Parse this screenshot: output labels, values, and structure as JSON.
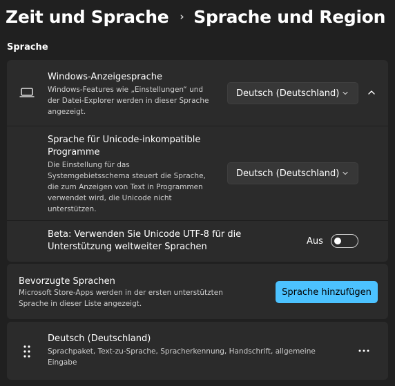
{
  "header": {
    "breadcrumb_parent": "Zeit und Sprache",
    "breadcrumb_separator": "›",
    "breadcrumb_current": "Sprache und Region"
  },
  "section": {
    "title": "Sprache"
  },
  "display_language": {
    "icon": "laptop-icon",
    "title": "Windows-Anzeigesprache",
    "description_lines": [
      "Windows-Features wie „Einstellungen“ und",
      "der Datei-Explorer werden in dieser Sprache",
      "angezeigt."
    ],
    "dropdown_value": "Deutsch (Deutschland)",
    "collapse_icon": "chevron-up-icon"
  },
  "unicode_language": {
    "title_lines": [
      "Sprache für Unicode-inkompatible",
      "Programme"
    ],
    "description_lines": [
      "Die Einstellung für das",
      "Systemgebietsschema steuert die Sprache,",
      "die zum Anzeigen von Text in Programmen",
      "verwendet wird, die Unicode nicht",
      "unterstützen."
    ],
    "dropdown_value": "Deutsch (Deutschland)"
  },
  "beta_utf8": {
    "title_lines": [
      "Beta: Verwenden Sie Unicode UTF-8 für die",
      "Unterstützung weltweiter Sprachen"
    ],
    "toggle_label": "Aus",
    "toggle_on": false
  },
  "preferred_languages": {
    "title": "Bevorzugte Sprachen",
    "description_lines": [
      "Microsoft Store-Apps werden in der ersten unterstützten",
      "Sprache in dieser Liste angezeigt."
    ],
    "add_button_label": "Sprache hinzufügen"
  },
  "language_item": {
    "drag_icon": "drag-handle-icon",
    "title": "Deutsch (Deutschland)",
    "description_lines": [
      "Sprachpaket, Text-zu-Sprache, Spracherkennung, Handschrift, allgemeine",
      "Eingabe"
    ],
    "more_icon": "more-options-icon"
  },
  "colors": {
    "background": "#202020",
    "card": "#2b2b2b",
    "accent": "#4cc2ff",
    "secondary_text": "#cfcfcf"
  }
}
